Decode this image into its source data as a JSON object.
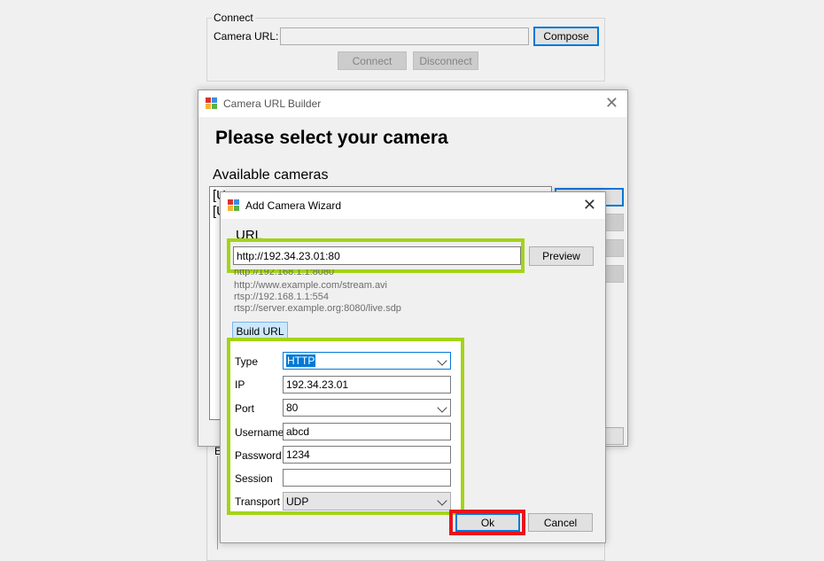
{
  "connect": {
    "group_title": "Connect",
    "camera_url_label": "Camera URL:",
    "camera_url_value": "",
    "compose_label": "Compose",
    "connect_label": "Connect",
    "disconnect_label": "Disconnect"
  },
  "builder": {
    "title": "Camera URL Builder",
    "heading": "Please select your camera",
    "available_cameras_label": "Available cameras",
    "list_items": [
      "[U",
      "[U"
    ],
    "bottom_group_partial": "E"
  },
  "wizard": {
    "title": "Add Camera Wizard",
    "url_label": "URL",
    "url_value": "http://192.34.23.01:80",
    "preview_label": "Preview",
    "hints": [
      "http://192.168.1.1:8080",
      "http://www.example.com/stream.avi",
      "rtsp://192.168.1.1:554",
      "rtsp://server.example.org:8080/live.sdp"
    ],
    "build_tab_label": "Build URL",
    "fields": {
      "type_label": "Type",
      "type_value": "HTTP",
      "ip_label": "IP",
      "ip_value": "192.34.23.01",
      "port_label": "Port",
      "port_value": "80",
      "username_label": "Username",
      "username_value": "abcd",
      "password_label": "Password",
      "password_value": "1234",
      "session_label": "Session",
      "session_value": "",
      "transport_label": "Transport",
      "transport_value": "UDP"
    },
    "ok_label": "Ok",
    "cancel_label": "Cancel"
  },
  "colors": {
    "highlight_green": "#a3d417",
    "highlight_red": "#e8141b",
    "accent": "#0078d7"
  }
}
